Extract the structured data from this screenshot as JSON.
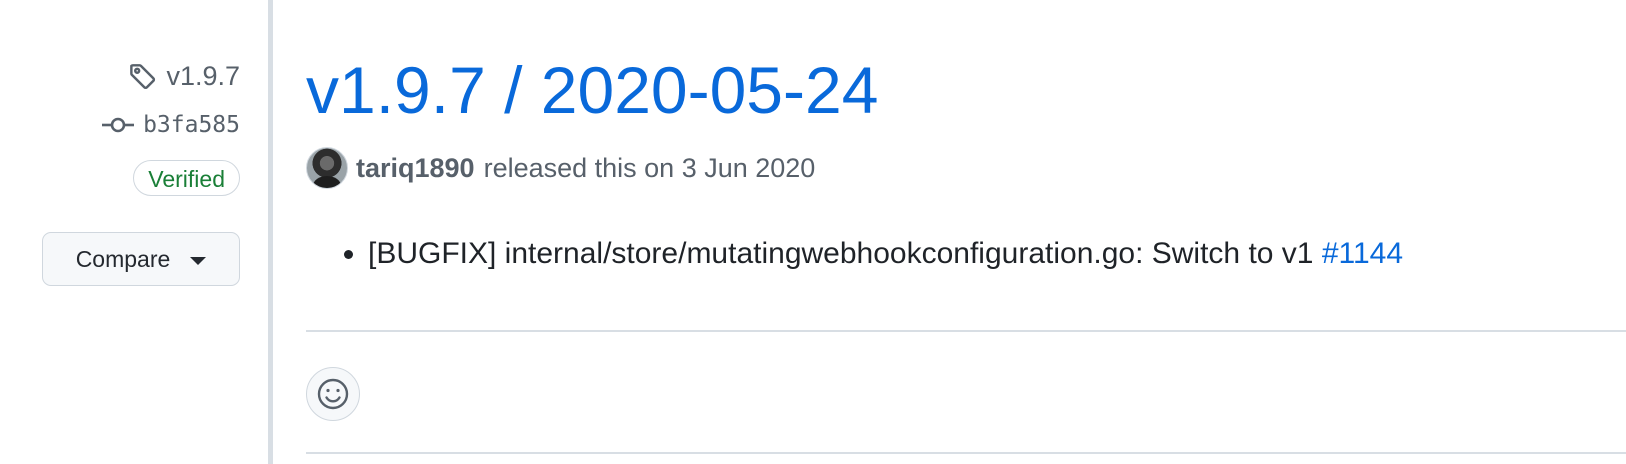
{
  "sidebar": {
    "tag": "v1.9.7",
    "commit": "b3fa585",
    "verified_label": "Verified",
    "compare_label": "Compare"
  },
  "release": {
    "title": "v1.9.7 / 2020-05-24",
    "author": "tariq1890",
    "released_text": "released this on 3 Jun 2020",
    "notes": [
      {
        "text": "[BUGFIX] internal/store/mutatingwebhookconfiguration.go: Switch to v1 ",
        "link": "#1144"
      }
    ]
  },
  "icons": {
    "tag": "tag-icon",
    "commit": "git-commit-icon",
    "caret": "triangle-down-icon",
    "reaction": "smiley-icon"
  },
  "colors": {
    "link": "#0969da",
    "muted": "#57606a",
    "verified": "#1a7f37",
    "border": "#d0d7de"
  }
}
